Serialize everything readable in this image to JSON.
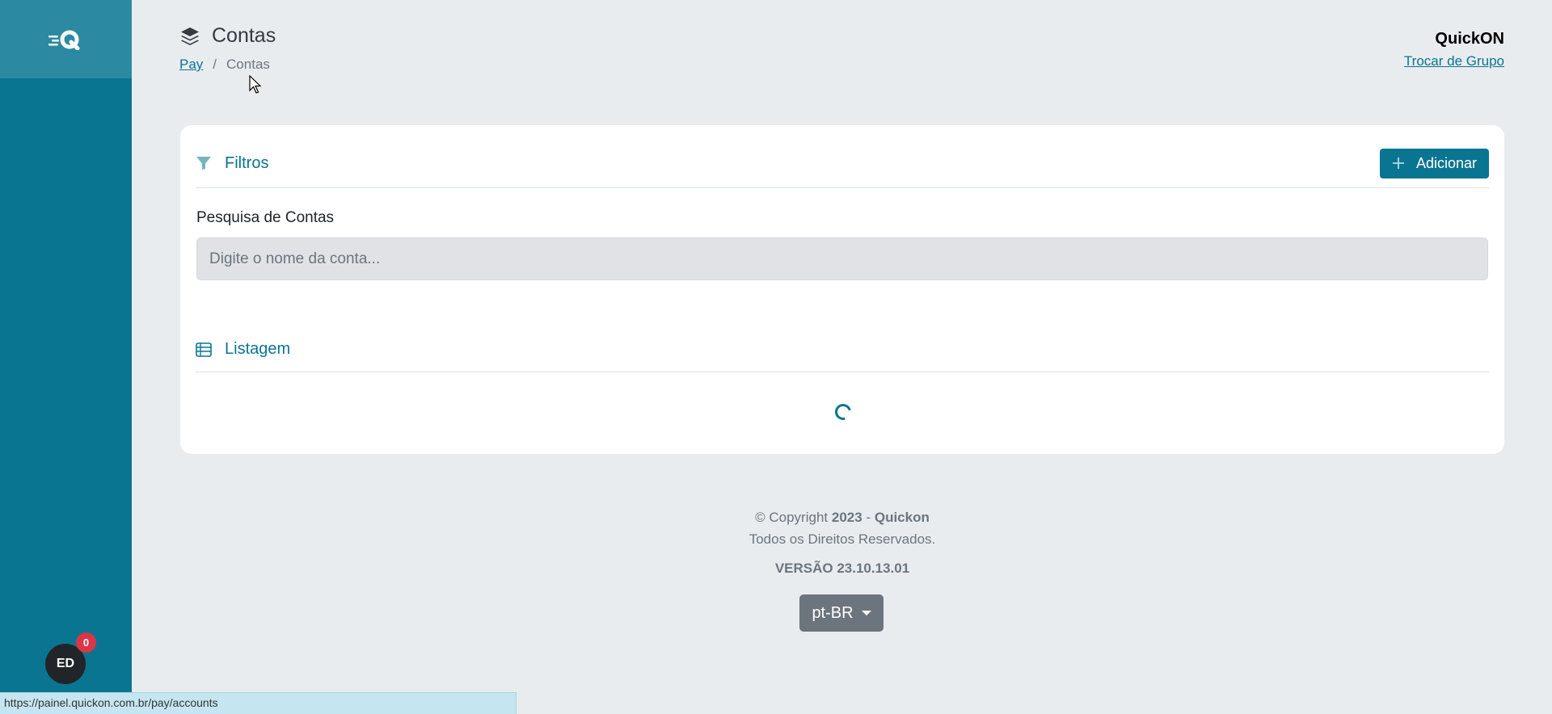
{
  "page": {
    "title": "Contas",
    "breadcrumb": {
      "parent": "Pay",
      "separator": "/",
      "current": "Contas"
    }
  },
  "org": {
    "name": "QuickON",
    "switch_label": "Trocar de Grupo"
  },
  "filters": {
    "title": "Filtros",
    "add_label": "Adicionar",
    "search_label": "Pesquisa de Contas",
    "search_placeholder": "Digite o nome da conta...",
    "search_value": ""
  },
  "listing": {
    "title": "Listagem",
    "loading": true
  },
  "footer": {
    "copyright_prefix": "© Copyright",
    "year": "2023",
    "dash": "-",
    "brand": "Quickon",
    "rights": "Todos os Direitos Reservados.",
    "version": "VERSÃO 23.10.13.01",
    "language": "pt-BR"
  },
  "user": {
    "initials": "ED",
    "notifications": "0"
  },
  "status_bar": {
    "url": "https://painel.quickon.com.br/pay/accounts"
  },
  "colors": {
    "primary": "#0a7591",
    "sidebar_top": "#2b8aa2",
    "background": "#e9ecef",
    "badge": "#dc3545",
    "lang_button": "#6c757d"
  },
  "icons": {
    "logo": "quickon-logo-icon",
    "title": "layers-icon",
    "filters": "filter-icon",
    "add": "plus-icon",
    "listing": "table-list-icon",
    "language": "caret-down-icon"
  }
}
